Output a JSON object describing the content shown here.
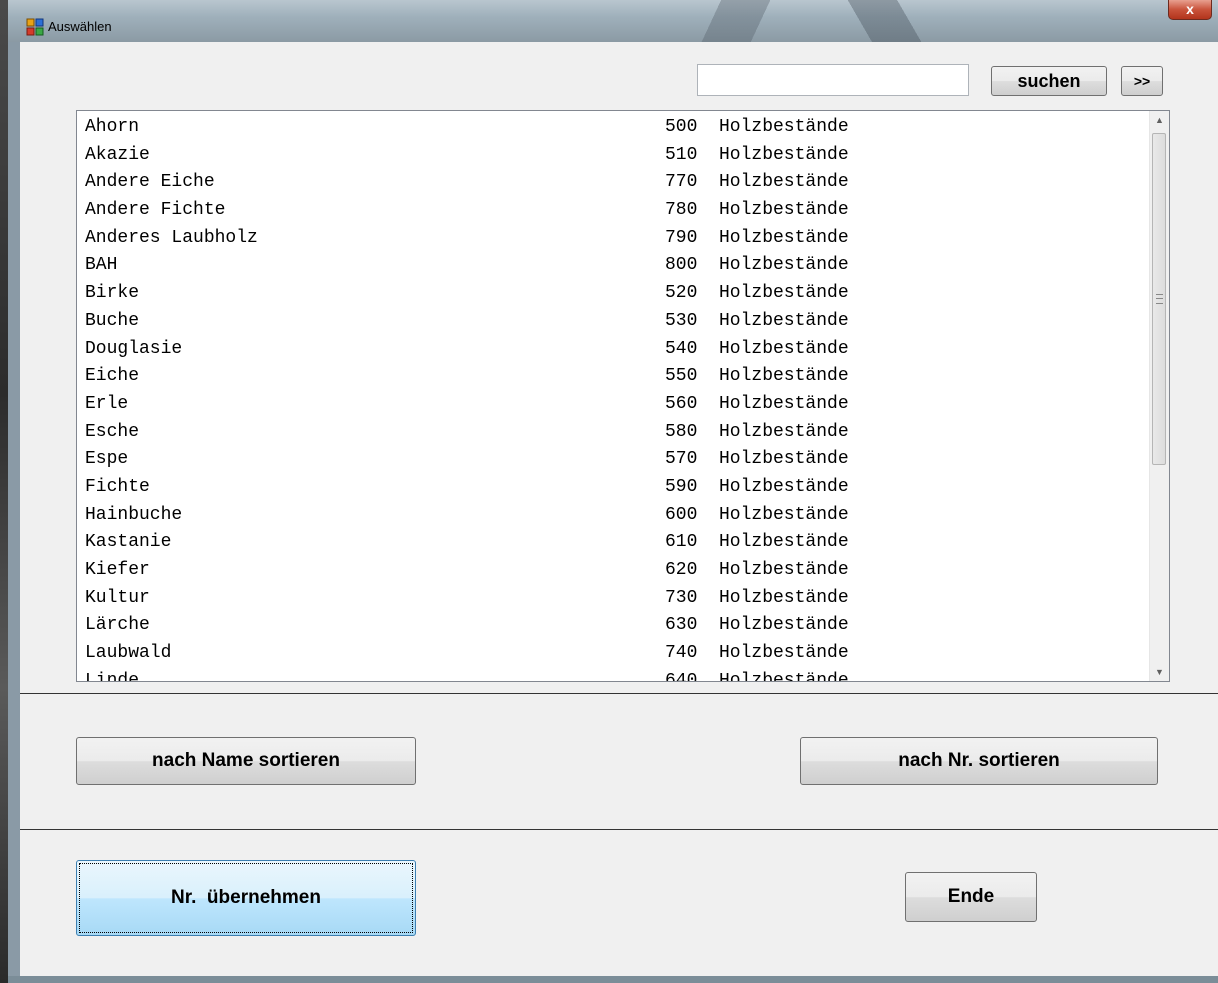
{
  "window": {
    "title": "Auswählen",
    "close_label": "x"
  },
  "search": {
    "value": "",
    "placeholder": "",
    "button_label": "suchen",
    "next_label": ">>"
  },
  "list": {
    "items": [
      {
        "name": "Ahorn",
        "nr": "500",
        "category": "Holzbestände"
      },
      {
        "name": "Akazie",
        "nr": "510",
        "category": "Holzbestände"
      },
      {
        "name": "Andere Eiche",
        "nr": "770",
        "category": "Holzbestände"
      },
      {
        "name": "Andere Fichte",
        "nr": "780",
        "category": "Holzbestände"
      },
      {
        "name": "Anderes Laubholz",
        "nr": "790",
        "category": "Holzbestände"
      },
      {
        "name": "BAH",
        "nr": "800",
        "category": "Holzbestände"
      },
      {
        "name": "Birke",
        "nr": "520",
        "category": "Holzbestände"
      },
      {
        "name": "Buche",
        "nr": "530",
        "category": "Holzbestände"
      },
      {
        "name": "Douglasie",
        "nr": "540",
        "category": "Holzbestände"
      },
      {
        "name": "Eiche",
        "nr": "550",
        "category": "Holzbestände"
      },
      {
        "name": "Erle",
        "nr": "560",
        "category": "Holzbestände"
      },
      {
        "name": "Esche",
        "nr": "580",
        "category": "Holzbestände"
      },
      {
        "name": "Espe",
        "nr": "570",
        "category": "Holzbestände"
      },
      {
        "name": "Fichte",
        "nr": "590",
        "category": "Holzbestände"
      },
      {
        "name": "Hainbuche",
        "nr": "600",
        "category": "Holzbestände"
      },
      {
        "name": "Kastanie",
        "nr": "610",
        "category": "Holzbestände"
      },
      {
        "name": "Kiefer",
        "nr": "620",
        "category": "Holzbestände"
      },
      {
        "name": "Kultur",
        "nr": "730",
        "category": "Holzbestände"
      },
      {
        "name": "Lärche",
        "nr": "630",
        "category": "Holzbestände"
      },
      {
        "name": "Laubwald",
        "nr": "740",
        "category": "Holzbestände"
      },
      {
        "name": "Linde",
        "nr": "640",
        "category": "Holzbestände"
      }
    ]
  },
  "sort": {
    "by_name_label": "nach Name sortieren",
    "by_nr_label": "nach Nr. sortieren"
  },
  "actions": {
    "apply_label": "Nr.  übernehmen",
    "end_label": "Ende"
  },
  "colors": {
    "client_bg": "#f0f0f0",
    "focus_button": "#bee6fd",
    "close_button": "#c9533b"
  },
  "icons": {
    "app": "app-icon",
    "close": "close-icon"
  }
}
